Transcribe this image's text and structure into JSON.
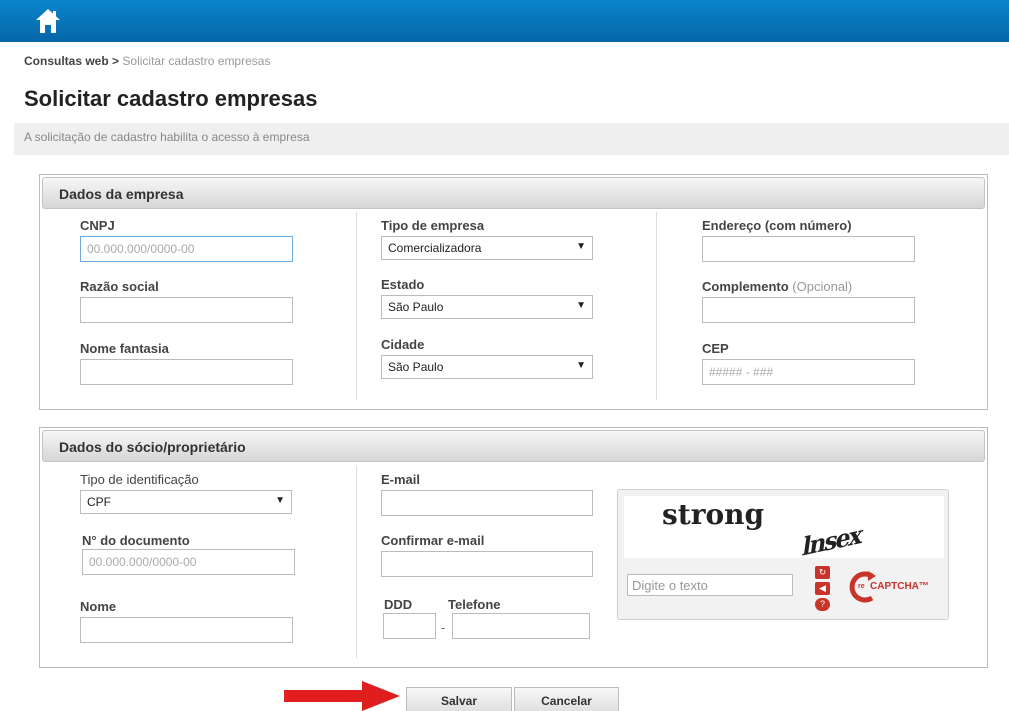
{
  "header": {
    "home_icon": "home-icon",
    "bar_color": "#0874bb"
  },
  "breadcrumb": {
    "root": "Consultas web",
    "separator": ">",
    "current": "Solicitar cadastro empresas"
  },
  "page": {
    "title": "Solicitar cadastro empresas",
    "subtitle": "A solicitação de cadastro habilita o acesso à empresa"
  },
  "empresa": {
    "header": "Dados da empresa",
    "cnpj_label": "CNPJ",
    "cnpj_placeholder": "00.000.000/0000-00",
    "razao_label": "Razão social",
    "fantasia_label": "Nome fantasia",
    "tipo_label": "Tipo de empresa",
    "tipo_value": "Comercializadora",
    "estado_label": "Estado",
    "estado_value": "São Paulo",
    "cidade_label": "Cidade",
    "cidade_value": "São Paulo",
    "endereco_label": "Endereço (com número)",
    "complemento_label": "Complemento",
    "complemento_opt": "(Opcional)",
    "cep_label": "CEP",
    "cep_placeholder": "##### - ###"
  },
  "socio": {
    "header": "Dados do sócio/proprietário",
    "tipo_id_label": "Tipo de identificação",
    "tipo_id_value": "CPF",
    "doc_label": "N° do documento",
    "doc_placeholder": "00.000.000/0000-00",
    "nome_label": "Nome",
    "email_label": "E-mail",
    "confirm_label": "Confirmar e-mail",
    "ddd_label": "DDD",
    "tel_label": "Telefone",
    "dash": "-"
  },
  "captcha": {
    "word1": "strong",
    "word2": "lnsex",
    "input_placeholder": "Digite o texto",
    "logo_re": "re",
    "logo_text": "CAPTCHA™"
  },
  "actions": {
    "save": "Salvar",
    "cancel": "Cancelar"
  },
  "colors": {
    "accent_red": "#e01e1e",
    "captcha_red": "#c8342a"
  }
}
